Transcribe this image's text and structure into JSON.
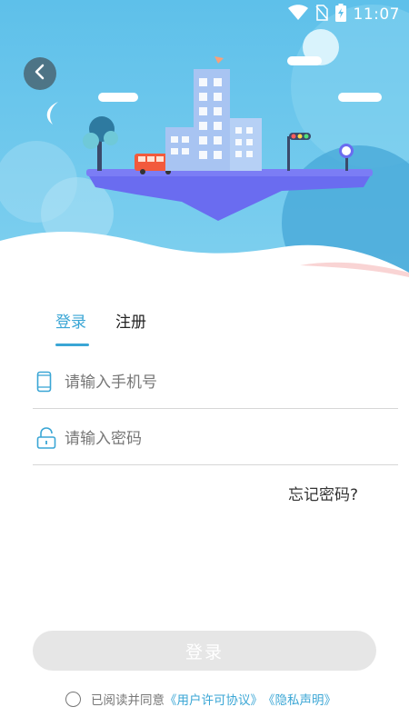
{
  "status_bar": {
    "time": "11:07",
    "icons": [
      "wifi-icon",
      "no-sim-icon",
      "battery-charging-icon"
    ]
  },
  "header": {
    "back_icon": "chevron-left-icon",
    "illustration": "floating-city-island"
  },
  "tabs": [
    {
      "label": "登录",
      "active": true
    },
    {
      "label": "注册",
      "active": false
    }
  ],
  "form": {
    "phone_placeholder": "请输入手机号",
    "phone_icon": "phone-icon",
    "password_placeholder": "请输入密码",
    "password_icon": "lock-icon",
    "forgot_label": "忘记密码?"
  },
  "login_button": {
    "label": "登录"
  },
  "agreement": {
    "prefix": "已阅读并同意",
    "user_license": "《用户许可协议》",
    "privacy": "《隐私声明》",
    "checked": false
  },
  "colors": {
    "accent": "#3aa6d5",
    "sky": "#6cc4e8",
    "island": "#6a6cf0",
    "button_disabled": "#e6e6e6"
  }
}
